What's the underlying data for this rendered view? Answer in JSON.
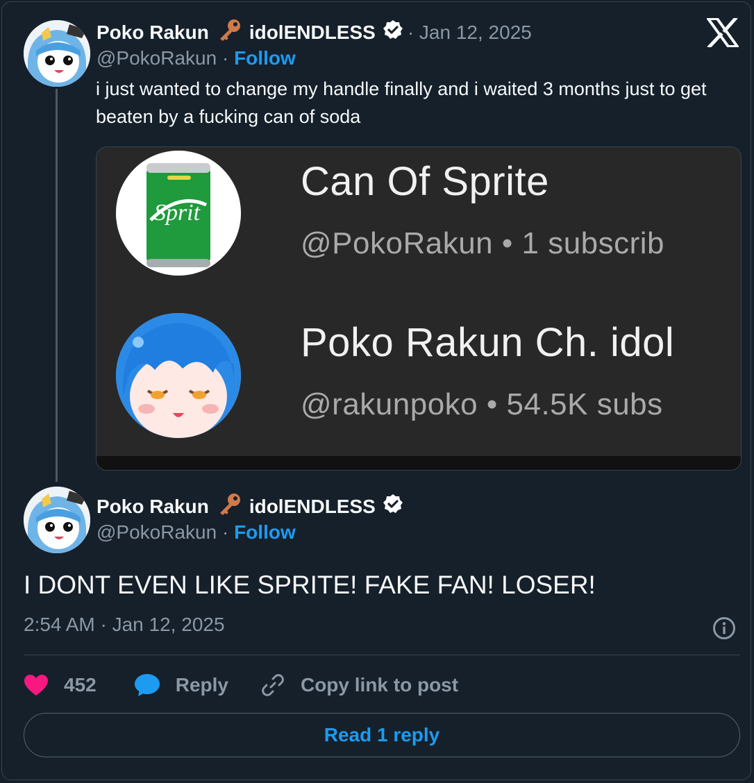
{
  "tweet1": {
    "display_name": "Poko Rakun",
    "name_suffix": "idolENDLESS",
    "separator_date": "· Jan 12, 2025",
    "handle": "@PokoRakun ·",
    "follow_label": "Follow",
    "text": "i just wanted to change my handle finally and i waited 3 months just to get beaten by a fucking can of soda"
  },
  "media": {
    "channel1": {
      "title": "Can Of Sprite",
      "subtitle": "@PokoRakun • 1 subscrib"
    },
    "channel2": {
      "title": "Poko Rakun Ch. idol",
      "subtitle": "@rakunpoko • 54.5K subs"
    }
  },
  "tweet2": {
    "display_name": "Poko Rakun",
    "name_suffix": "idolENDLESS",
    "handle": "@PokoRakun ·",
    "follow_label": "Follow",
    "text": "I DONT EVEN LIKE SPRITE! FAKE FAN! LOSER!",
    "timestamp": "2:54 AM · Jan 12, 2025"
  },
  "actions": {
    "likes": "452",
    "reply_label": "Reply",
    "copy_label": "Copy link to post",
    "read_replies_label": "Read 1 reply"
  },
  "icons": {
    "x_logo": "x-logo-icon",
    "key": "key-icon",
    "verified": "verified-badge-icon",
    "heart": "heart-icon",
    "reply": "reply-bubble-icon",
    "link": "link-icon",
    "info": "info-icon"
  },
  "colors": {
    "background": "#15202b",
    "accent": "#1d9bf0",
    "like": "#f91880",
    "muted": "#8b98a5"
  }
}
